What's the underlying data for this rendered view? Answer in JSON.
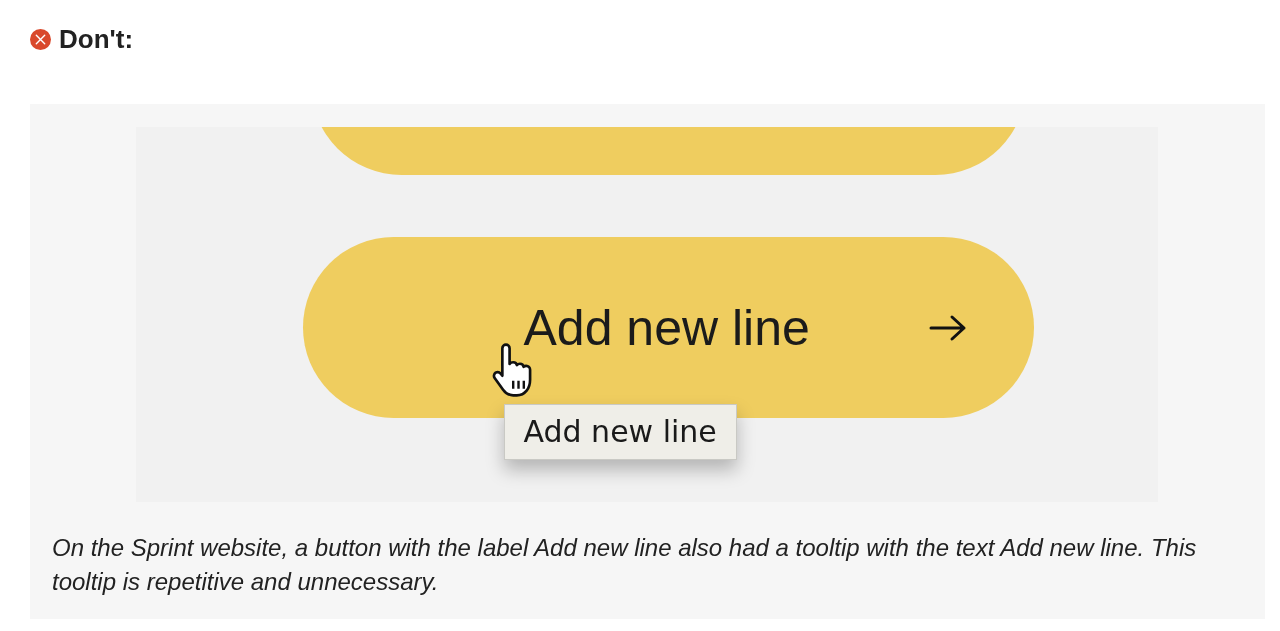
{
  "heading": {
    "text": "Don't:"
  },
  "example": {
    "buttons": [
      {
        "kind": "clipped"
      },
      {
        "kind": "full",
        "label": "Add new line"
      }
    ],
    "tooltip": {
      "text": "Add new line"
    }
  },
  "caption": {
    "text": "On the Sprint website, a button with the label Add new line also had a tooltip with the text Add new line. This tooltip is repetitive and unnecessary."
  }
}
